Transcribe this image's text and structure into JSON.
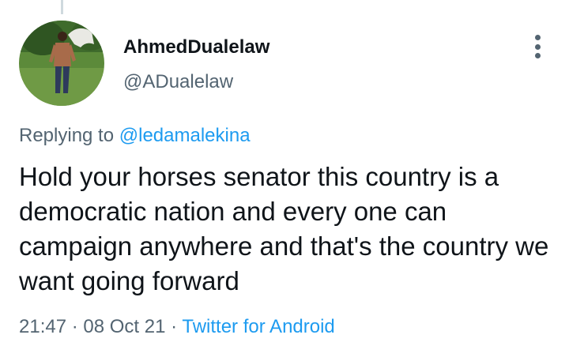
{
  "author": {
    "name": "AhmedDualelaw",
    "handle": "@ADualelaw",
    "avatar_icon": "profile-photo-icon"
  },
  "reply": {
    "prefix": "Replying to ",
    "mention": "@ledamalekina"
  },
  "tweet": {
    "text": "Hold your horses senator this country is a democratic nation and every one can campaign anywhere and that's the country we want going forward"
  },
  "meta": {
    "time": "21:47",
    "separator1": " · ",
    "date": "08 Oct 21",
    "separator2": " · ",
    "source": "Twitter for Android"
  },
  "colors": {
    "link": "#1d9bf0",
    "secondary_text": "#536471",
    "primary_text": "#0f1419"
  },
  "icons": {
    "more": "more-options-icon"
  }
}
